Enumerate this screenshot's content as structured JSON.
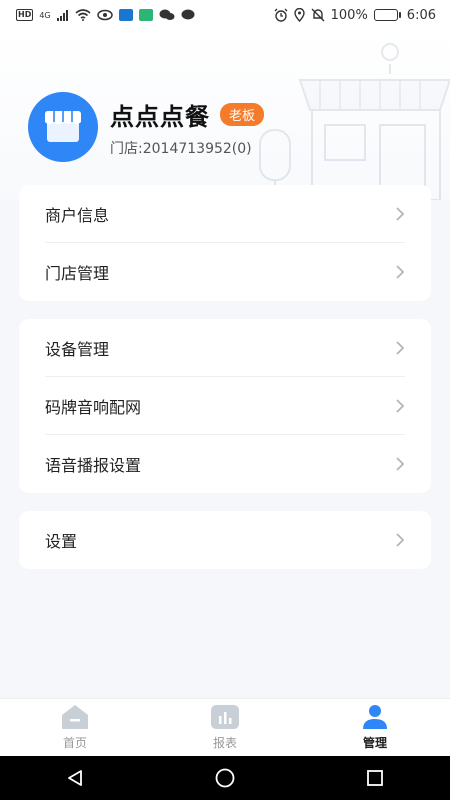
{
  "status_bar": {
    "hd": "HD",
    "signal": "4G",
    "battery": "100%",
    "time": "6:06"
  },
  "profile": {
    "shop_name": "点点点餐",
    "role": "老板",
    "store_id": "门店:2014713952(0)"
  },
  "menu_groups": [
    {
      "items": [
        {
          "label": "商户信息"
        },
        {
          "label": "门店管理"
        }
      ]
    },
    {
      "items": [
        {
          "label": "设备管理"
        },
        {
          "label": "码牌音响配网"
        },
        {
          "label": "语音播报设置"
        }
      ]
    },
    {
      "items": [
        {
          "label": "设置"
        }
      ]
    }
  ],
  "tabs": [
    {
      "label": "首页",
      "icon": "home-icon",
      "active": false
    },
    {
      "label": "报表",
      "icon": "report-icon",
      "active": false
    },
    {
      "label": "管理",
      "icon": "user-icon",
      "active": true
    }
  ],
  "colors": {
    "accent_blue": "#2f86f6",
    "badge_orange": "#f37b2a",
    "inactive_icon": "#c9cfd6"
  }
}
